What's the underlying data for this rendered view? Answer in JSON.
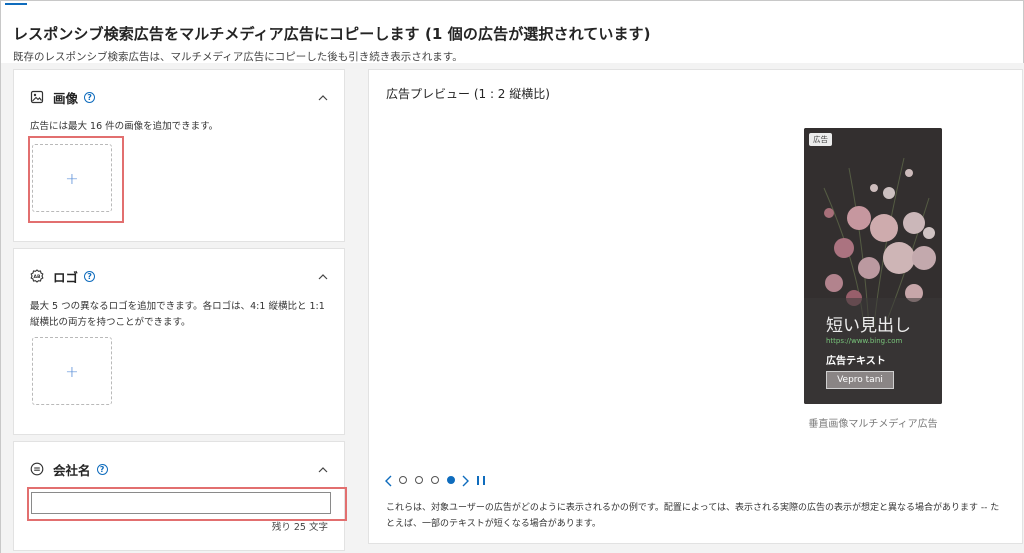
{
  "header": {
    "title": "レスポンシブ検索広告をマルチメディア広告にコピーします (1 個の広告が選択されています)",
    "subtitle": "既存のレスポンシブ検索広告は、マルチメディア広告にコピーした後も引き続き表示されます。"
  },
  "image_section": {
    "title": "画像",
    "help": "?",
    "description": "広告には最大 16 件の画像を追加できます。",
    "add_symbol": "+"
  },
  "logo_section": {
    "title": "ロゴ",
    "help": "?",
    "description_line1": "最大 5 つの異なるロゴを追加できます。各ロゴは、4:1 縦横比と 1:1",
    "description_line2": "縦横比の両方を持つことができます。",
    "add_symbol": "+"
  },
  "company_section": {
    "title": "会社名",
    "help": "?",
    "input_value": "",
    "counter": "残り 25 文字"
  },
  "preview": {
    "title": "広告プレビュー (1 : 2 縦横比)",
    "ad": {
      "badge": "広告",
      "headline": "短い見出し",
      "url": "https://www.bing.com",
      "text": "広告テキスト",
      "cta": "Vepro tani"
    },
    "caption": "垂直画像マルチメディア広告",
    "carousel": {
      "total": 4,
      "active_index": 3
    },
    "disclaimer": "これらは、対象ユーザーの広告がどのように表示されるかの例です。配置によっては、表示される実際の広告の表示が想定と異なる場合があります -- たとえば、一部のテキストが短くなる場合があります。"
  },
  "colors": {
    "accent": "#0f6cbd",
    "highlight": "#e26f6f",
    "ad_background": "#3c3838"
  }
}
